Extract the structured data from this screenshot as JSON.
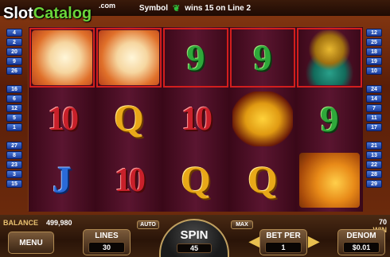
{
  "logo": {
    "text_main": "Slot",
    "text_accent": "Catalog",
    "suffix": ".com"
  },
  "win_message": {
    "prefix": "Symbol",
    "symbol_icon": "nine-leaf-icon",
    "suffix": "wins 15 on Line 2"
  },
  "paylines_left": [
    "4",
    "2",
    "20",
    "9",
    "26",
    "16",
    "6",
    "12",
    "5",
    "1",
    "27",
    "8",
    "23",
    "3",
    "15"
  ],
  "paylines_right": [
    "12",
    "25",
    "18",
    "19",
    "10",
    "24",
    "14",
    "7",
    "11",
    "17",
    "21",
    "13",
    "22",
    "28",
    "29"
  ],
  "reels": [
    [
      "lucky-cat",
      "10",
      "J"
    ],
    [
      "lucky-cat",
      "Q",
      "10"
    ],
    [
      "9",
      "10",
      "Q"
    ],
    [
      "9",
      "gold-ingot",
      "Q"
    ],
    [
      "golden-fish",
      "9",
      "golden-dragon"
    ]
  ],
  "highlighted": [
    [
      0,
      0
    ],
    [
      1,
      0
    ],
    [
      2,
      0
    ],
    [
      3,
      0
    ],
    [
      4,
      0
    ]
  ],
  "balance": {
    "label": "BALANCE",
    "value": "499,980"
  },
  "win": {
    "label": "WIN",
    "value": "70"
  },
  "buttons": {
    "menu": "MENU",
    "lines_label": "LINES",
    "lines_value": "30",
    "auto": "AUTO",
    "spin_label": "SPIN",
    "spin_value": "45",
    "max": "MAX",
    "betper_label": "BET PER",
    "betper_value": "1",
    "denom_label": "DENOM",
    "denom_value": "$0.01"
  },
  "colors": {
    "line_badge": "#2a4ab8",
    "highlight": "#d21e1e",
    "reel_bg": "#4a0f22"
  }
}
